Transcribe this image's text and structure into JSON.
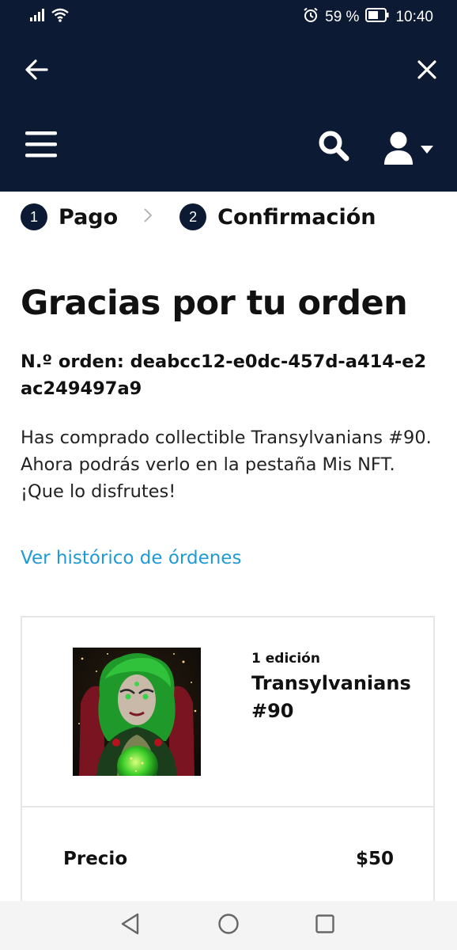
{
  "status_bar": {
    "battery_pct": "59 %",
    "time": "10:40",
    "icons": [
      "signal-icon",
      "wifi-icon",
      "alarm-icon",
      "battery-icon"
    ]
  },
  "header": {
    "back_icon": "arrow-left-icon",
    "close_icon": "close-icon",
    "menu_icon": "hamburger-menu-icon",
    "search_icon": "search-icon",
    "user_icon": "user-icon",
    "dropdown_icon": "caret-down-icon"
  },
  "steps": [
    {
      "number": "1",
      "label": "Pago"
    },
    {
      "number": "2",
      "label": "Confirmación"
    }
  ],
  "confirmation": {
    "title": "Gracias por tu orden",
    "order_line": "N.º orden: deabcc12-e0dc-457d-a414-e2ac249497a9",
    "message": "Has comprado collectible Transylvanians #90. Ahora podrás verlo en la pestaña Mis NFT. ¡Que lo disfrutes!",
    "history_link": "Ver histórico de órdenes"
  },
  "order_card": {
    "edition": "1 edición",
    "name": "Transylvanians #90",
    "price_label": "Precio",
    "price_value": "$50"
  },
  "nav_bar": {
    "icons": [
      "back-triangle-icon",
      "home-circle-icon",
      "recents-square-icon"
    ]
  },
  "colors": {
    "header_bg": "#0d1a33",
    "link": "#1e9ad6",
    "step_badge": "#0d1a33"
  }
}
